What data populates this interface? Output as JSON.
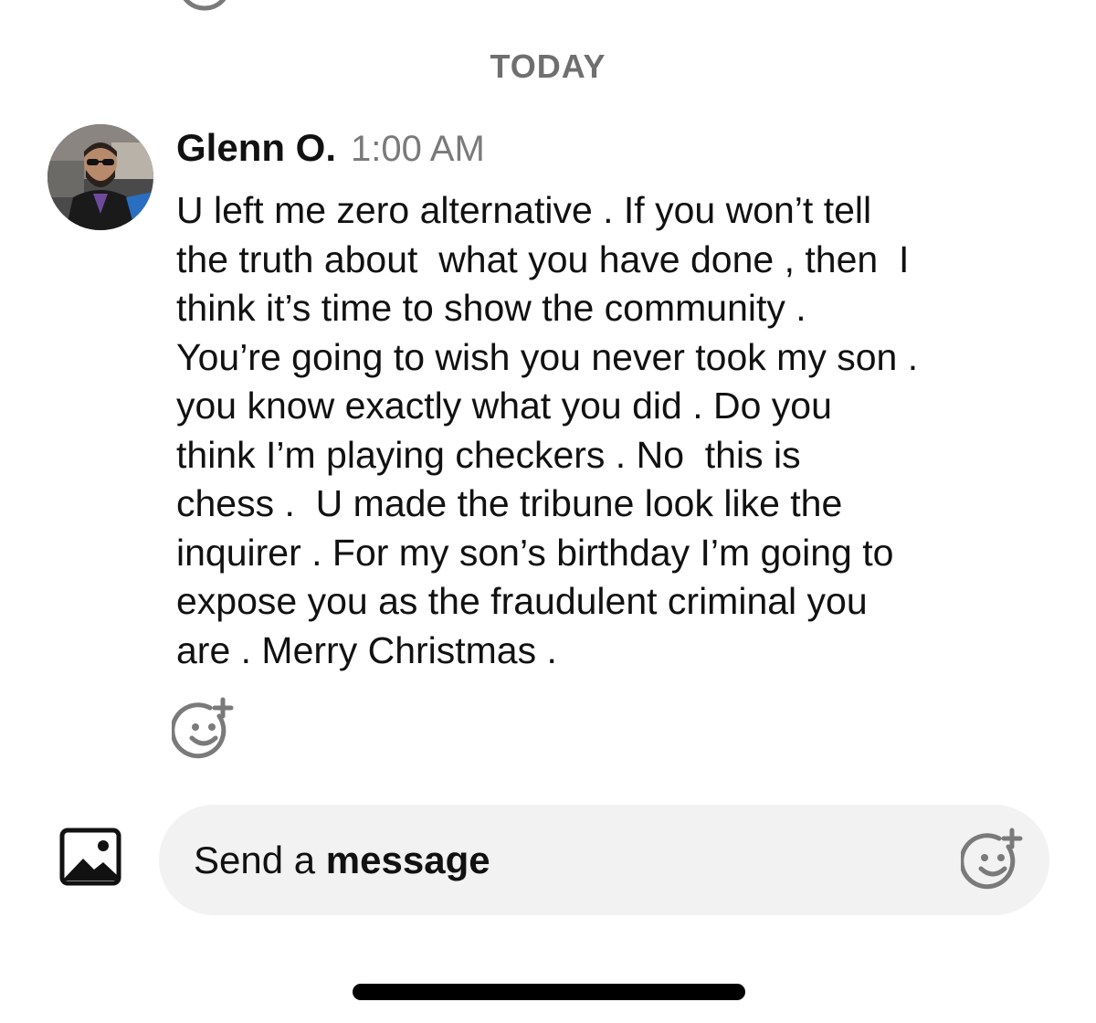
{
  "date_divider": "TODAY",
  "message": {
    "sender": "Glenn O.",
    "time": "1:00 AM",
    "text": "U left me zero alternative . If you won’t tell\nthe truth about  what you have done , then  I\nthink it’s time to show the community .\nYou’re going to wish you never took my son .\nyou know exactly what you did . Do you\nthink I’m playing checkers . No  this is\nchess .  U made the tribune look like the\ninquirer . For my son’s birthday I’m going to\nexpose you as the fraudulent criminal you\nare . Merry Christmas ."
  },
  "composer": {
    "placeholder_regular": "Send a ",
    "placeholder_bold": "message"
  },
  "icons": {
    "reaction": "add-reaction-icon",
    "photo": "photo-gallery-icon",
    "composer_emoji": "add-emoji-icon"
  },
  "colors": {
    "icon_gray": "#7a7a7a",
    "composer_bg": "#f2f2f2",
    "muted_text": "#6f6f6f"
  }
}
